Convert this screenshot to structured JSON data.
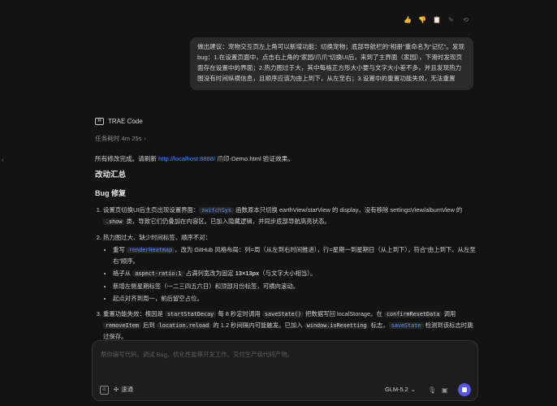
{
  "top_actions": [
    "👍",
    "👎",
    "📋",
    "✎",
    "⟲"
  ],
  "user_message": "做出建议：宠物交互页左上角可以新增功能：切换宠物；底部导航栏的“相册”重命名为“记忆”。发现bug：1.在设置页面中，点击右上角的“家园/爪爪”切换UI后，来到了主界面（家园），下滑时发现页面存在设置中的界面；2.热力图过于大，其中每格正方形大小要与文字大小差不多，并且发现热力图没有时间纵横信息，且顺序应该为由上到下，从左至右；3.设置中的重置功能失效，无法重置",
  "assistant": {
    "name": "TRAE Code",
    "logo": "⌘",
    "task_time": "任务耗时 4m 25s",
    "done_prefix": "所有修改完成。请刷新 ",
    "done_link": "http://localhost:8888/",
    "done_suffix": " 爪印-Demo.html 验证效果。",
    "heading_summary": "改动汇总",
    "heading_bug": "Bug 修复",
    "items": {
      "i1_a": "设置页切换UI后主页出现设置界面：",
      "i1_code": "switchSys",
      "i1_b": " 函数原本只切换 earthView/starView 的 display，没有移除 settingsView/albumView 的 ",
      "i1_code2": ".show",
      "i1_c": " 类，导致它们仍叠加在内容区。已加入隐藏逻辑，并同步底部导航高亮状态。",
      "i2_a": "热力图过大、缺少时间标签、顺序不对：",
      "i2_s1_a": "重写 ",
      "i2_s1_code": "renderHeatmap",
      "i2_s1_b": "，改为 GitHub 风格布局：列=周（从左到右时间推进），行=星期一到星期日（从上到下），符合“由上到下、从左至右”顺序。",
      "i2_s2_a": "格子从 ",
      "i2_s2_code": "aspect-ratio:1",
      "i2_s2_b": " 占满列宽改为固定 ",
      "i2_s2_bold": "13×13px",
      "i2_s2_c": "（与文字大小相当）。",
      "i2_s3": "新增左侧星期标签（一二三四五六日）和顶部月份标签，可横向滚动。",
      "i2_s4": "起点对齐到周一，前后留空占位。",
      "i3_a": "重置功能失效：根因是 ",
      "i3_code1": "startStatDecay",
      "i3_b": " 每 8 秒定时调用 ",
      "i3_code2": "saveState()",
      "i3_c": " 把数据写回 localStorage。在 ",
      "i3_code3": "confirmResetData",
      "i3_d": " 调用 ",
      "i3_code4": "removeItem",
      "i3_e": " 后到 ",
      "i3_code5": "location.reload",
      "i3_f": " 的 1.2 秒间隔内可能触发。已加入 ",
      "i3_code6": "window.isResetting",
      "i3_g": " 标志，",
      "i3_code7": "saveState",
      "i3_h": " 检测到该标志时跳过保存。"
    }
  },
  "composer": {
    "placeholder": "帮你编写代码、调试 Bug、优化性能等开发工作。交付生产级代码产物。",
    "context_icon": "⊘",
    "speed_label": "速通",
    "speed_icon": "✣",
    "model": "GLM-5.2",
    "model_chevron": "⌄",
    "mic_icon": "🎙",
    "image_icon": "▣"
  },
  "left_chevron": "‹"
}
